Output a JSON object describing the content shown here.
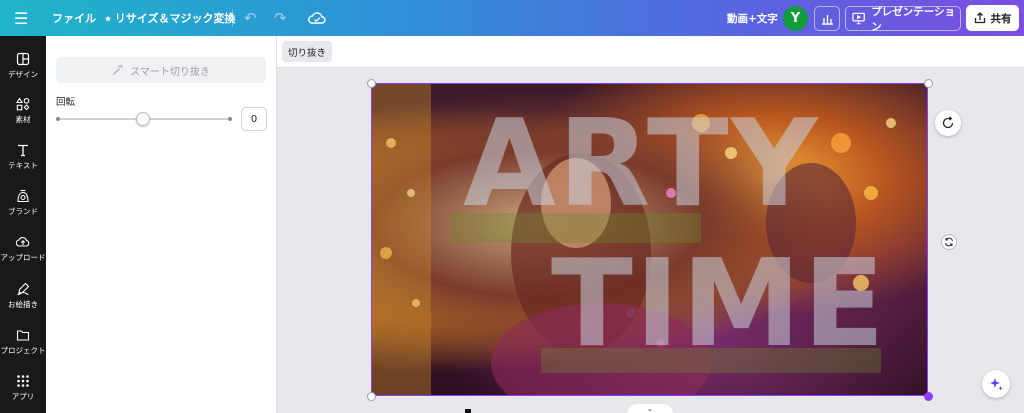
{
  "topbar": {
    "file_label": "ファイル",
    "resize_label": "⭑ リサイズ＆マジック変換",
    "doc_title": "動画+文字",
    "avatar_initial": "Y",
    "present_label": "プレゼンテーション",
    "share_label": "共有",
    "gradient_colors": [
      "#1fb5c9",
      "#5b62e0",
      "#7a4fe0"
    ]
  },
  "leftnav": {
    "items": [
      {
        "label": "デザイン",
        "icon": "layout-icon"
      },
      {
        "label": "素材",
        "icon": "shapes-icon"
      },
      {
        "label": "テキスト",
        "icon": "text-icon"
      },
      {
        "label": "ブランド",
        "icon": "brand-icon"
      },
      {
        "label": "アップロード",
        "icon": "cloud-upload-icon"
      },
      {
        "label": "お絵描き",
        "icon": "draw-icon"
      },
      {
        "label": "プロジェクト",
        "icon": "folder-icon"
      },
      {
        "label": "アプリ",
        "icon": "apps-icon"
      }
    ]
  },
  "panel": {
    "smart_crop_label": "スマート切り抜き",
    "rotation_label": "回転",
    "rotation_value": "0"
  },
  "context_toolbar": {
    "crop_label": "切り抜き"
  },
  "canvas": {
    "text_line_1": "ARTY",
    "text_line_2": "TIME",
    "selection_color": "#8b3dff"
  }
}
